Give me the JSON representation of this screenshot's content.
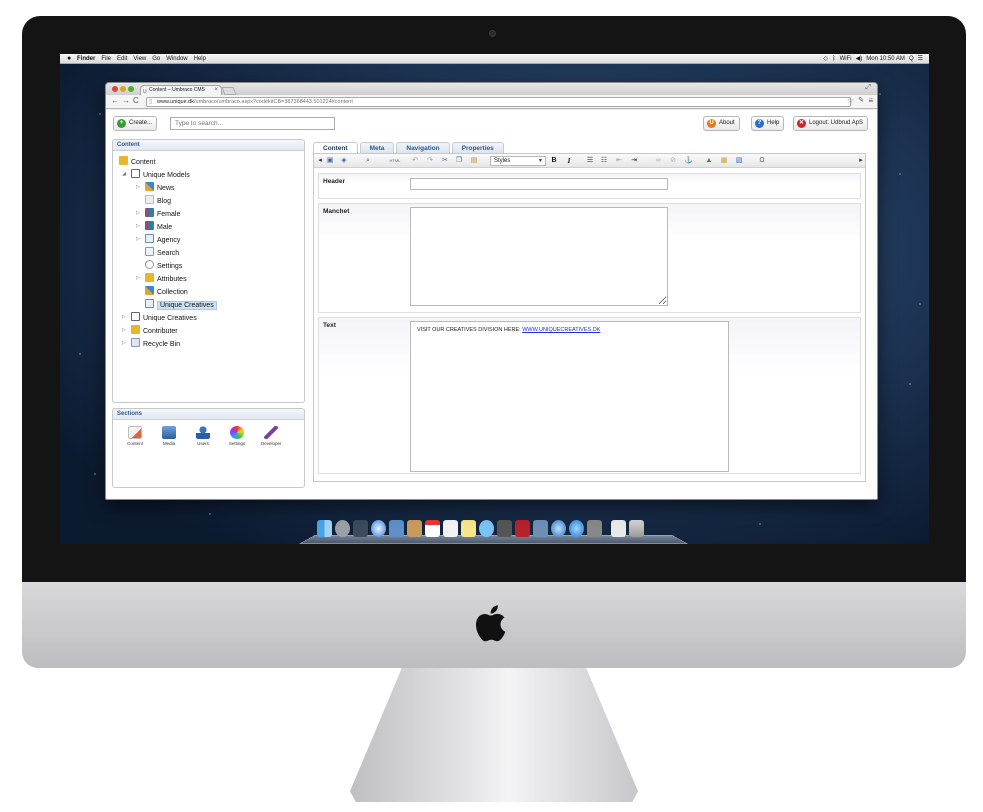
{
  "menubar": {
    "items": [
      "Finder",
      "File",
      "Edit",
      "View",
      "Go",
      "Window",
      "Help"
    ],
    "status": [
      "◇",
      "ᛒ",
      "WiFi",
      "◀)",
      "Mon 10:50 AM",
      "Q",
      "☰"
    ]
  },
  "browser": {
    "tab_title": "Content – Umbraco CMS",
    "url_host": "www.unique.dk",
    "url_path": "/umbraco/umbraco.aspx?codekitCB=387368443.501224#content"
  },
  "toolbar": {
    "create_label": "Create...",
    "search_placeholder": "Type to search...",
    "about_label": "About",
    "help_label": "Help",
    "logout_label": "Logout: Udbrud ApS"
  },
  "content_panel": {
    "title": "Content",
    "tree": {
      "root": "Content",
      "unique_models": "Unique Models",
      "news": "News",
      "blog": "Blog",
      "female": "Female",
      "male": "Male",
      "agency": "Agency",
      "search": "Search",
      "settings": "Settings",
      "attributes": "Attributes",
      "collection": "Collection",
      "unique_creatives_child": "Unique Creatives",
      "unique_creatives": "Unique Creatives",
      "contributer": "Contributer",
      "recycle_bin": "Recycle Bin"
    }
  },
  "sections_panel": {
    "title": "Sections",
    "items": [
      "Content",
      "Media",
      "Users",
      "Settings",
      "Developer"
    ]
  },
  "editor": {
    "tabs": [
      "Content",
      "Meta",
      "Navigation",
      "Properties"
    ],
    "styles_label": "Styles",
    "bold": "B",
    "italic": "I",
    "html_label": "HTML",
    "omega": "Ω",
    "header_label": "Header",
    "manchet_label": "Manchet",
    "text_label": "Text",
    "text_body_prefix": "VISIT OUR CREATIVES DIVISION HERE: ",
    "text_body_link": "WWW.UNIQUECREATIVES.DK"
  },
  "colors": {
    "selection": "#cce3f7",
    "link": "#1b2fd6",
    "tab_text": "#2a5b8c"
  }
}
